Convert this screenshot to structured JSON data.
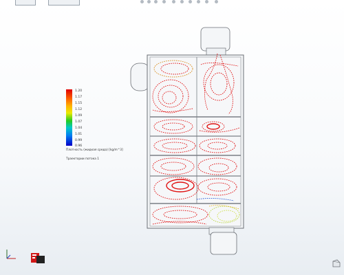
{
  "legend": {
    "ticks": [
      "1.20",
      "1.17",
      "1.15",
      "1.12",
      "1.09",
      "1.07",
      "1.04",
      "1.01",
      "0.99",
      "0.96"
    ],
    "parameter": "Плотность (жидкая среда) [kg/m^3]",
    "caption": "Траектории потока 1",
    "colors": [
      "#e00000",
      "#ff6a00",
      "#ffb600",
      "#eaea00",
      "#22cc22",
      "#00c8c8",
      "#007cf2",
      "#0000c8"
    ]
  },
  "model": {
    "body_color": "#f2f4f6",
    "outline_color": "#6b6f75",
    "flow_color": "#e01010",
    "flow_color_warm": "#d68a18",
    "flow_color_cool": "#b8d43a"
  },
  "icons": [
    "zoom-to-fit-icon",
    "zoom-area-icon",
    "previous-view-icon",
    "section-view-icon",
    "view-orientation-icon",
    "display-style-icon",
    "hide-show-icon",
    "edit-appearance-icon",
    "scene-icon",
    "view-settings-icon"
  ]
}
